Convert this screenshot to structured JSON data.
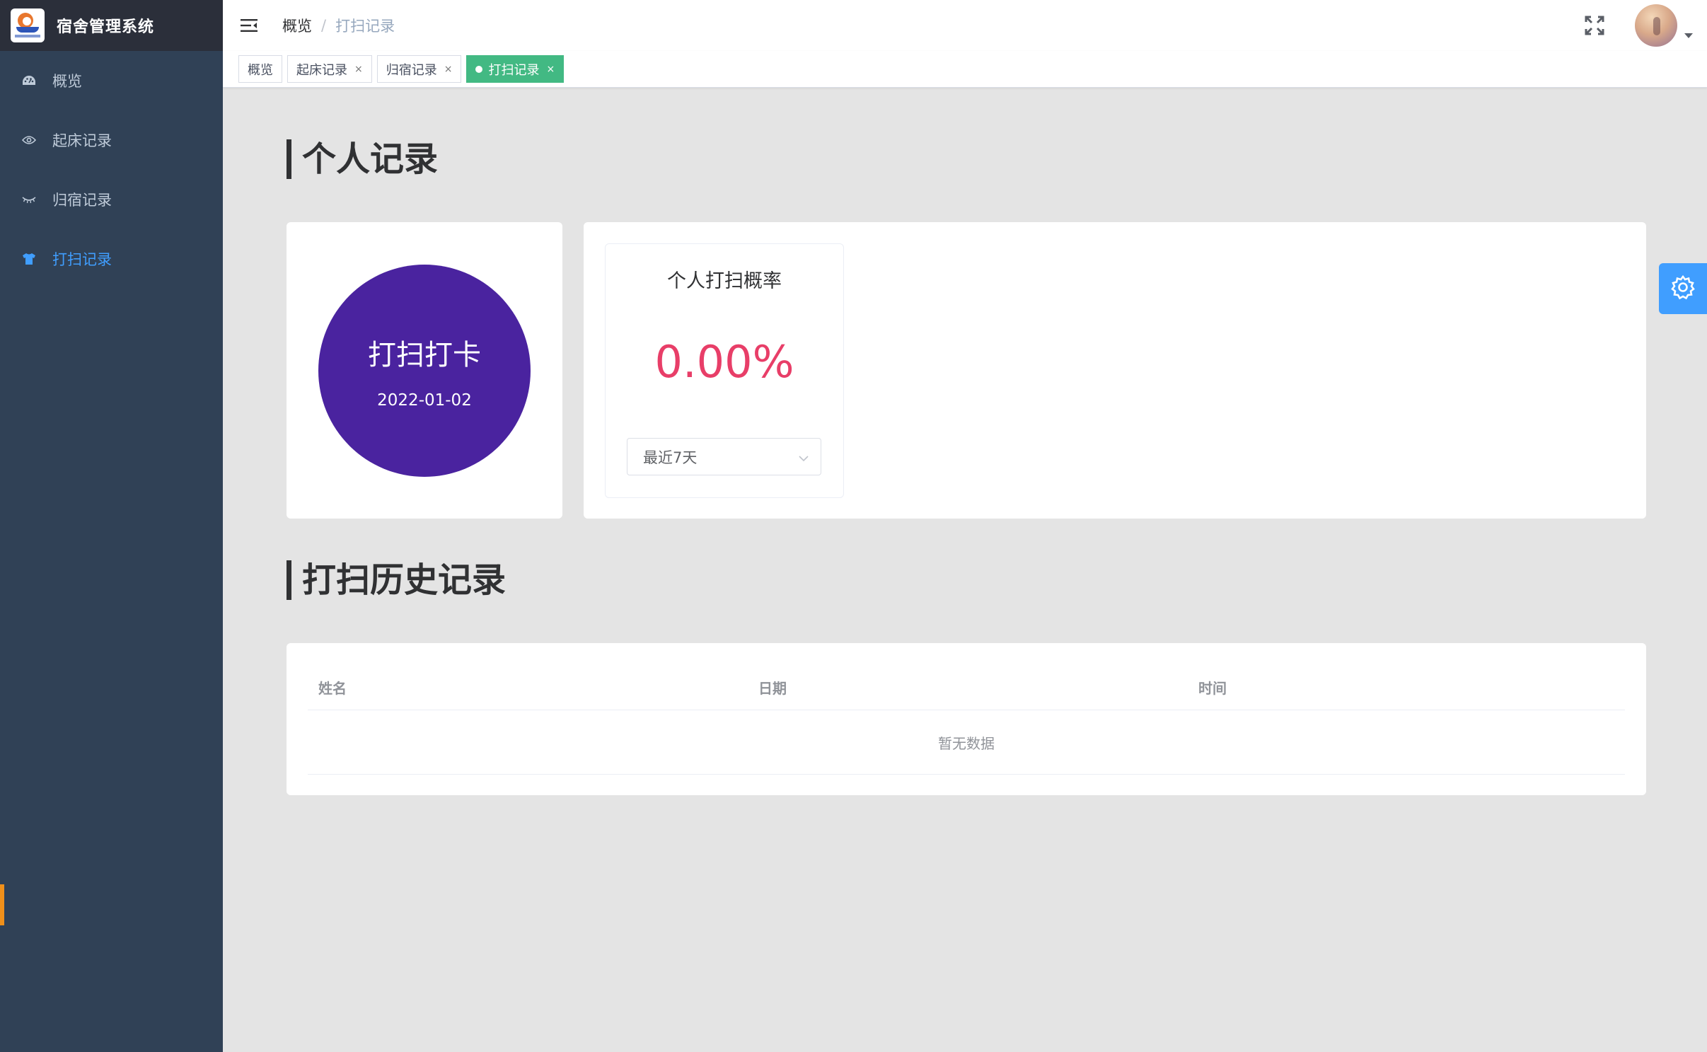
{
  "app": {
    "title": "宿舍管理系统"
  },
  "sidebar": {
    "items": [
      {
        "label": "概览",
        "icon": "dashboard-icon",
        "active": false
      },
      {
        "label": "起床记录",
        "icon": "eye-icon",
        "active": false
      },
      {
        "label": "归宿记录",
        "icon": "eye-closed-icon",
        "active": false
      },
      {
        "label": "打扫记录",
        "icon": "shirt-icon",
        "active": true
      }
    ]
  },
  "navbar": {
    "breadcrumb": {
      "home": "概览",
      "separator": "/",
      "current": "打扫记录"
    }
  },
  "tags": [
    {
      "label": "概览",
      "closable": false,
      "active": false
    },
    {
      "label": "起床记录",
      "closable": true,
      "active": false
    },
    {
      "label": "归宿记录",
      "closable": true,
      "active": false
    },
    {
      "label": "打扫记录",
      "closable": true,
      "active": true
    }
  ],
  "tag_close_glyph": "×",
  "personal": {
    "section_title": "个人记录",
    "checkin": {
      "title": "打扫打卡",
      "date": "2022-01-02"
    },
    "stat": {
      "title": "个人打扫概率",
      "value": "0.00%",
      "range_selected": "最近7天"
    }
  },
  "history": {
    "section_title": "打扫历史记录",
    "columns": [
      "姓名",
      "日期",
      "时间"
    ],
    "empty_text": "暂无数据"
  },
  "colors": {
    "sidebar_bg": "#304156",
    "brand_bg": "#2b2f3a",
    "menu_active": "#409eff",
    "tag_active": "#42b983",
    "checkin_circle": "#4a239f",
    "stat_value": "#e83e68",
    "settings_button": "#409eff"
  }
}
